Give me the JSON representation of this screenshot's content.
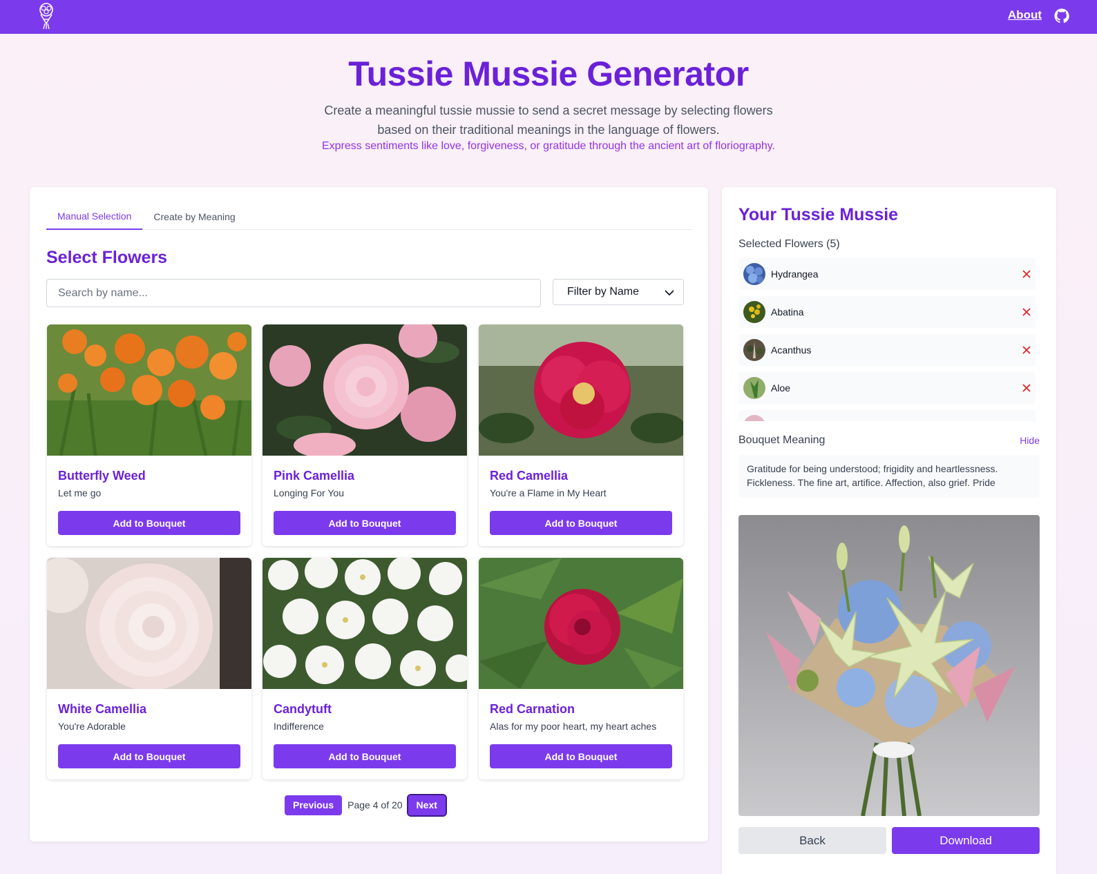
{
  "nav": {
    "about_label": "About"
  },
  "hero": {
    "title": "Tussie Mussie Generator",
    "subtitle": "Create a meaningful tussie mussie to send a secret message by selecting flowers based on their traditional meanings in the language of flowers.",
    "accent": "Express sentiments like love, forgiveness, or gratitude through the ancient art of floriography."
  },
  "selector": {
    "tabs": [
      {
        "label": "Manual Selection",
        "active": true
      },
      {
        "label": "Create by Meaning",
        "active": false
      }
    ],
    "section_title": "Select Flowers",
    "search_placeholder": "Search by name...",
    "filter_value": "Filter by Name",
    "add_label": "Add to Bouquet",
    "cards": [
      {
        "name": "Butterfly Weed",
        "meaning": "Let me go"
      },
      {
        "name": "Pink Camellia",
        "meaning": "Longing For You"
      },
      {
        "name": "Red Camellia",
        "meaning": "You're a Flame in My Heart"
      },
      {
        "name": "White Camellia",
        "meaning": "You're Adorable"
      },
      {
        "name": "Candytuft",
        "meaning": "Indifference"
      },
      {
        "name": "Red Carnation",
        "meaning": "Alas for my poor heart, my heart aches"
      }
    ],
    "pager": {
      "prev_label": "Previous",
      "page_text": "Page 4 of 20",
      "next_label": "Next"
    }
  },
  "bouquet": {
    "title": "Your Tussie Mussie",
    "count_label": "Selected Flowers (5)",
    "selected": [
      {
        "name": "Hydrangea"
      },
      {
        "name": "Abatina"
      },
      {
        "name": "Acanthus"
      },
      {
        "name": "Aloe"
      }
    ],
    "meaning_label": "Bouquet Meaning",
    "hide_label": "Hide",
    "meaning_text": "Gratitude for being understood; frigidity and heartlessness. Fickleness. The fine art, artifice. Affection, also grief. Pride",
    "back_label": "Back",
    "download_label": "Download"
  },
  "colors": {
    "accent": "#7c3aed",
    "heading": "#6b21d8",
    "remove": "#dc2626"
  }
}
